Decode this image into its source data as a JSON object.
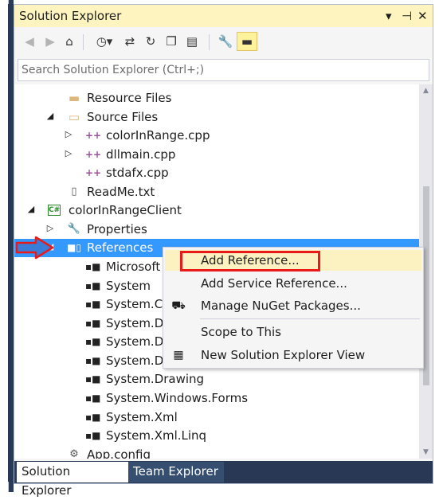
{
  "panel": {
    "title": "Solution Explorer",
    "title_buttons": [
      "▾",
      "⊣",
      "✕"
    ]
  },
  "toolbar": {
    "icons": [
      "back-icon",
      "forward-icon",
      "home-icon",
      "history-icon",
      "sync-icon",
      "refresh-icon",
      "collapse-all-icon",
      "show-all-files-icon",
      "properties-icon",
      "preview-icon"
    ]
  },
  "search": {
    "placeholder": "Search Solution Explorer (Ctrl+;)"
  },
  "tree": {
    "items": [
      {
        "label": "Resource Files",
        "icon": "folder-icon",
        "expander": ""
      },
      {
        "label": "Source Files",
        "icon": "folder-open-icon",
        "expander": "◢"
      },
      {
        "label": "colorInRange.cpp",
        "icon": "cpp-file-icon",
        "expander": "▷"
      },
      {
        "label": "dllmain.cpp",
        "icon": "cpp-file-icon",
        "expander": "▷"
      },
      {
        "label": "stdafx.cpp",
        "icon": "cpp-file-icon",
        "expander": ""
      },
      {
        "label": "ReadMe.txt",
        "icon": "text-file-icon",
        "expander": ""
      },
      {
        "label": "colorInRangeClient",
        "icon": "csharp-project-icon",
        "expander": "◢"
      },
      {
        "label": "Properties",
        "icon": "wrench-icon",
        "expander": "▷"
      },
      {
        "label": "References",
        "icon": "references-icon",
        "expander": "◢"
      },
      {
        "label": "Microsoft",
        "icon": "reference-icon",
        "expander": ""
      },
      {
        "label": "System",
        "icon": "reference-icon",
        "expander": ""
      },
      {
        "label": "System.Co",
        "icon": "reference-icon",
        "expander": ""
      },
      {
        "label": "System.Da",
        "icon": "reference-icon",
        "expander": ""
      },
      {
        "label": "System.Da",
        "icon": "reference-icon",
        "expander": ""
      },
      {
        "label": "System.Da",
        "icon": "reference-icon",
        "expander": ""
      },
      {
        "label": "System.Drawing",
        "icon": "reference-icon",
        "expander": ""
      },
      {
        "label": "System.Windows.Forms",
        "icon": "reference-icon",
        "expander": ""
      },
      {
        "label": "System.Xml",
        "icon": "reference-icon",
        "expander": ""
      },
      {
        "label": "System.Xml.Linq",
        "icon": "reference-icon",
        "expander": ""
      },
      {
        "label": "App.config",
        "icon": "config-file-icon",
        "expander": ""
      }
    ]
  },
  "context_menu": {
    "items": [
      {
        "label": "Add Reference...",
        "icon": ""
      },
      {
        "label": "Add Service Reference...",
        "icon": ""
      },
      {
        "label": "Manage NuGet Packages...",
        "icon": "nuget-icon"
      },
      {
        "label": "Scope to This",
        "icon": ""
      },
      {
        "label": "New Solution Explorer View",
        "icon": "new-view-icon"
      }
    ]
  },
  "tabs": [
    {
      "label": "Solution Explorer"
    },
    {
      "label": "Team Explorer"
    }
  ],
  "colors": {
    "title_bar": "#fdf4bf",
    "selection": "#3399ff",
    "menu_hover": "#fcf2c1",
    "annotation_red": "#e81a1a",
    "annotation_arrow_blue": "#3a7dd8",
    "tab_bar": "#293955"
  }
}
